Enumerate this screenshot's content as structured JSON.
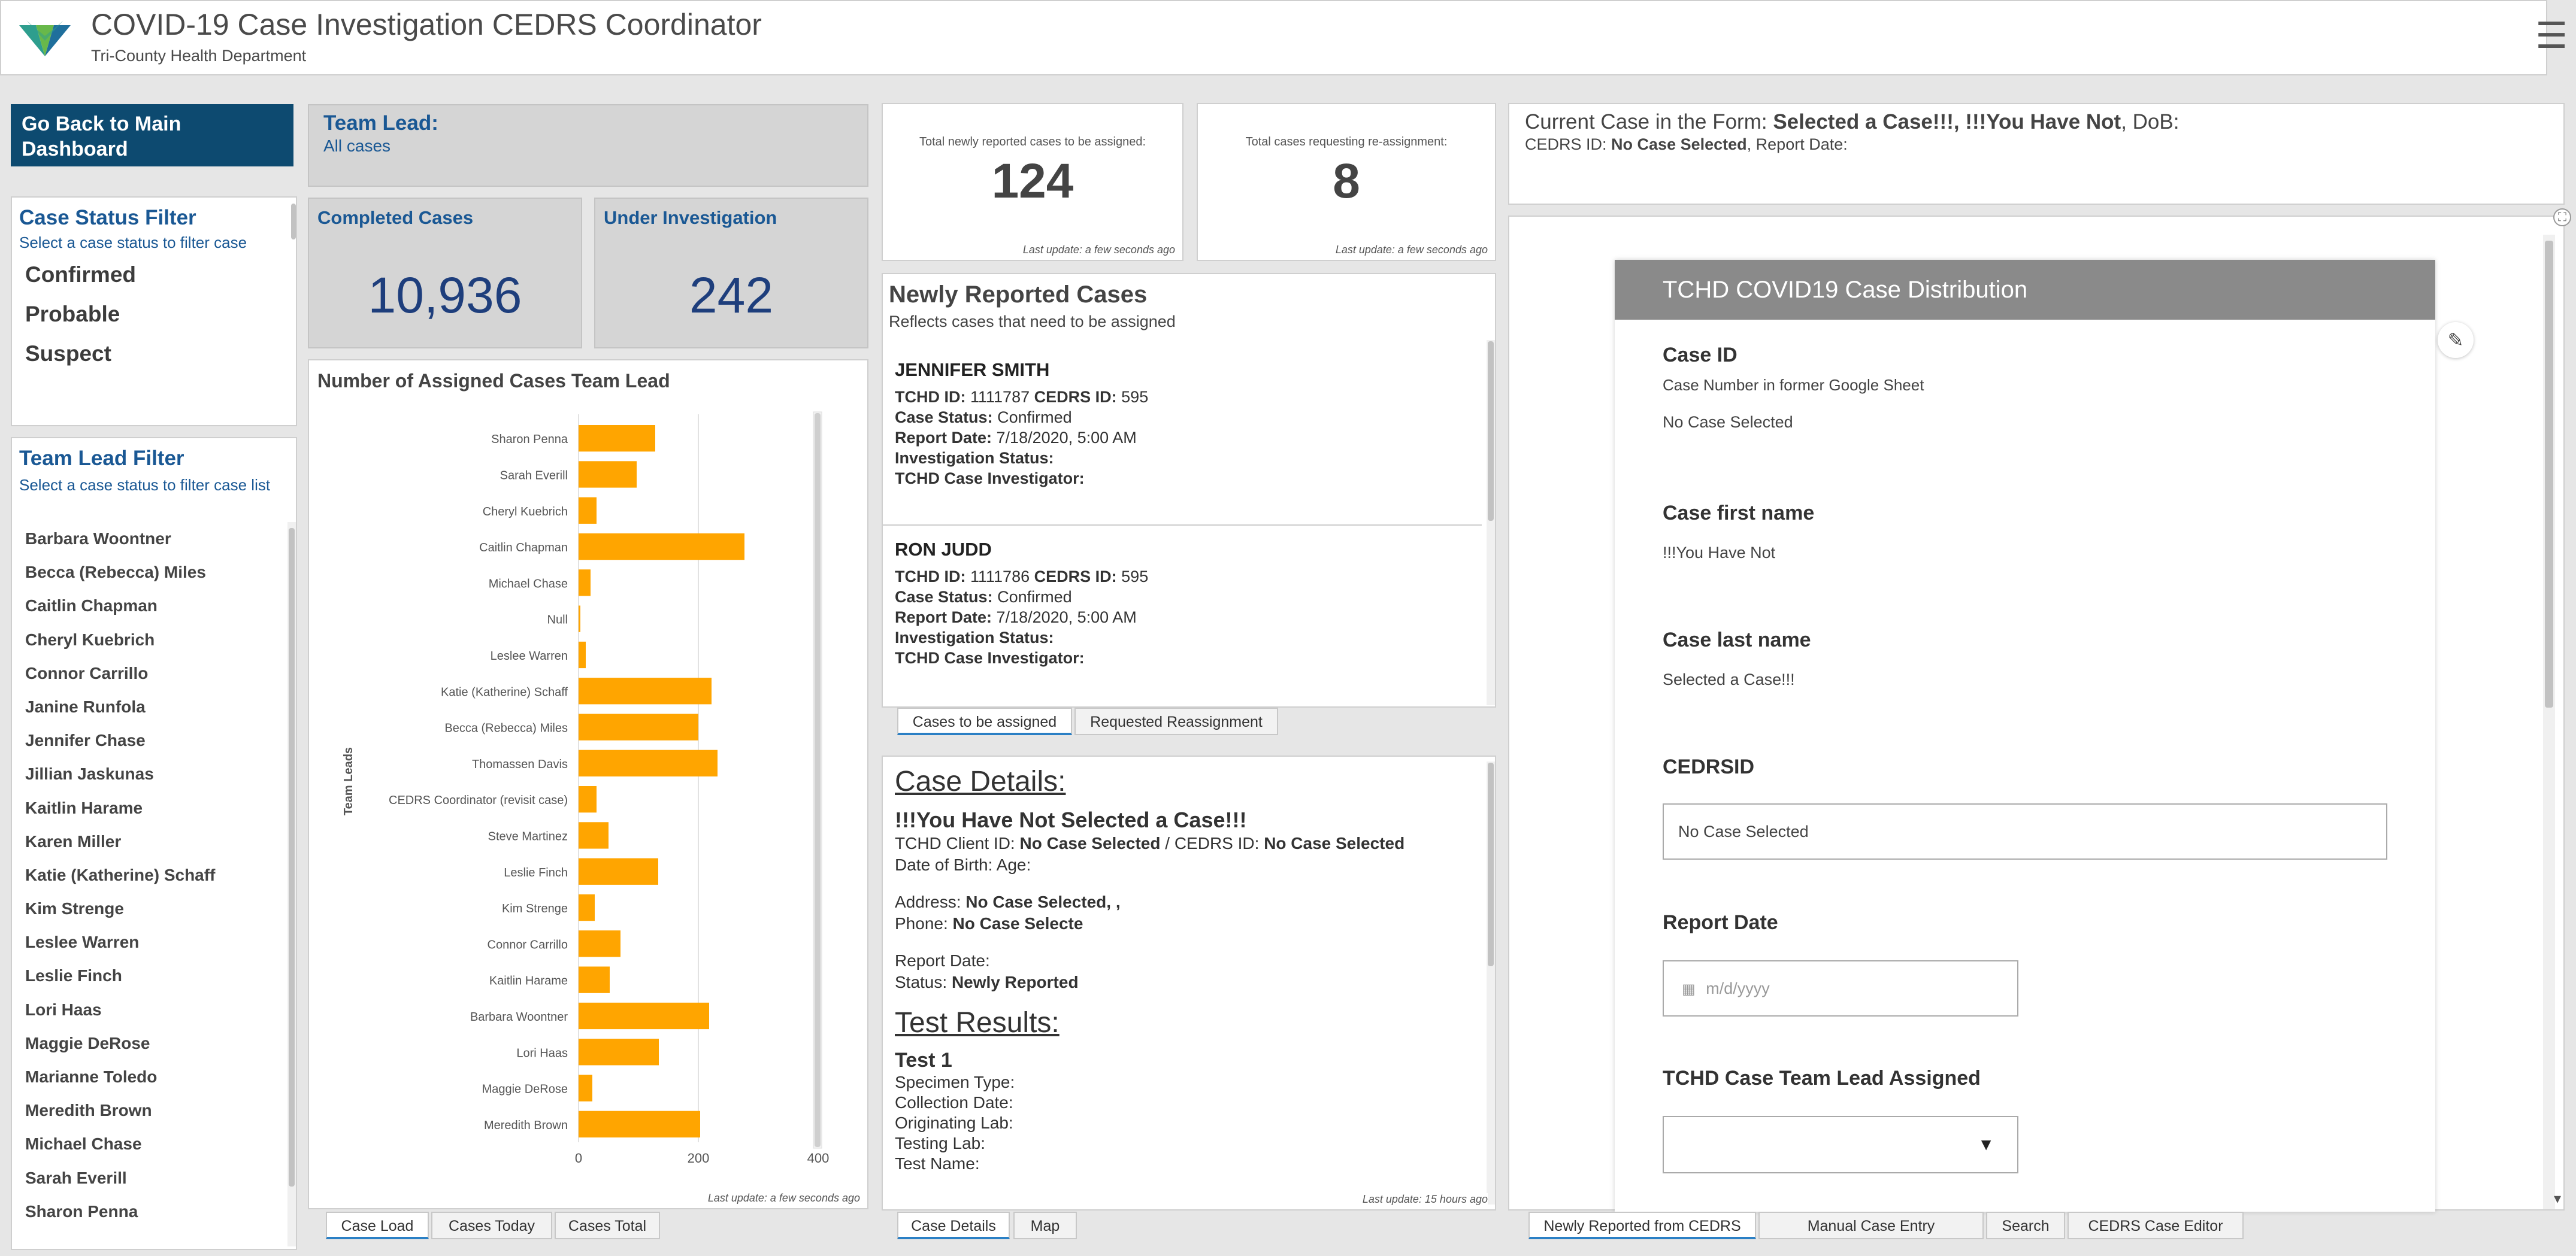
{
  "header": {
    "title": "COVID-19 Case Investigation CEDRS Coordinator",
    "subtitle": "Tri-County Health Department",
    "menu_icon": "☰"
  },
  "left": {
    "back_button": "Go Back to Main Dashboard",
    "status_filter": {
      "title": "Case Status Filter",
      "hint": "Select a case status to filter case",
      "items": [
        "Confirmed",
        "Probable",
        "Suspect"
      ]
    },
    "team_filter": {
      "title": "Team Lead Filter",
      "hint": "Select a case status to filter case list",
      "items": [
        "Barbara Woontner",
        "Becca (Rebecca) Miles",
        "Caitlin Chapman",
        "Cheryl Kuebrich",
        "Connor Carrillo",
        "Janine Runfola",
        "Jennifer Chase",
        "Jillian Jaskunas",
        "Kaitlin Harame",
        "Karen Miller",
        "Katie (Katherine) Schaff",
        "Kim Strenge",
        "Leslee Warren",
        "Leslie Finch",
        "Lori Haas",
        "Maggie DeRose",
        "Marianne Toledo",
        "Meredith Brown",
        "Michael Chase",
        "Sarah Everill",
        "Sharon Penna"
      ]
    }
  },
  "teamlead": {
    "label": "Team Lead:",
    "value": "All cases"
  },
  "stats": {
    "completed_label": "Completed Cases",
    "completed_value": "10,936",
    "under_label": "Under Investigation",
    "under_value": "242"
  },
  "chart_data": {
    "type": "bar",
    "orientation": "horizontal",
    "title": "Number of Assigned Cases Team Lead",
    "ylabel": "Team Leads",
    "xlabel": "",
    "xlim": [
      0,
      400
    ],
    "xticks": [
      "0",
      "200",
      "400"
    ],
    "categories": [
      "Sharon Penna",
      "Sarah Everill",
      "Cheryl Kuebrich",
      "Caitlin Chapman",
      "Michael Chase",
      "Null",
      "Leslee Warren",
      "Katie (Katherine) Schaff",
      "Becca (Rebecca) Miles",
      "Thomassen Davis",
      "CEDRS Coordinator (revisit case)",
      "Steve Martinez",
      "Leslie Finch",
      "Kim Strenge",
      "Connor Carrillo",
      "Kaitlin Harame",
      "Barbara Woontner",
      "Lori Haas",
      "Maggie DeRose",
      "Meredith Brown"
    ],
    "values": [
      128,
      97,
      30,
      277,
      20,
      3,
      12,
      222,
      200,
      232,
      30,
      50,
      133,
      27,
      70,
      52,
      218,
      134,
      23,
      203
    ],
    "bar_color": "#ffa500",
    "grid": true,
    "update": "Last update: a few seconds ago"
  },
  "left_tabs": [
    "Case Load",
    "Cases Today",
    "Cases Total"
  ],
  "counters": {
    "new_label": "Total newly reported cases to be assigned:",
    "new_value": "124",
    "reassign_label": "Total cases requesting re-assignment:",
    "reassign_value": "8",
    "update": "Last update: a few seconds ago"
  },
  "newly": {
    "title": "Newly Reported Cases",
    "subtitle": "Reflects cases that need to be assigned",
    "cards": [
      {
        "name": "JENNIFER SMITH",
        "tchd_label": "TCHD ID:",
        "tchd": "1111787",
        "cedrs_label": "CEDRS ID:",
        "cedrs": "595",
        "status_label": "Case Status:",
        "status": "Confirmed",
        "report_label": "Report Date:",
        "report": "7/18/2020, 5:00 AM",
        "inv_label": "Investigation Status:",
        "investigator_label": "TCHD Case Investigator:"
      },
      {
        "name": "RON JUDD",
        "tchd_label": "TCHD ID:",
        "tchd": "1111786",
        "cedrs_label": "CEDRS ID:",
        "cedrs": "595",
        "status_label": "Case Status:",
        "status": "Confirmed",
        "report_label": "Report Date:",
        "report": "7/18/2020, 5:00 AM",
        "inv_label": "Investigation Status:",
        "investigator_label": "TCHD Case Investigator:"
      }
    ],
    "tabs": [
      "Cases to be assigned",
      "Requested Reassignment"
    ]
  },
  "details": {
    "title": "Case Details:",
    "heading": "!!!You Have Not  Selected a Case!!!",
    "client_line_a": "TCHD Client ID:",
    "client_val": "No Case Selected",
    "client_sep": "/ CEDRS ID:",
    "cedrs_val": "No Case Selected",
    "dob": "Date of Birth:    Age:",
    "address_label": "Address:",
    "address": "No Case Selected, ,",
    "phone_label": "Phone:",
    "phone": "No Case Selecte",
    "report_date": "Report Date:",
    "status_label": "Status:",
    "status": "Newly Reported",
    "test_title": "Test Results:",
    "test1": "Test 1",
    "test_lines": [
      "Specimen Type:",
      "Collection Date:",
      "Originating Lab:",
      "Testing Lab:",
      "Test Name:"
    ],
    "update": "Last update: 15 hours ago",
    "tabs": [
      "Case Details",
      "Map"
    ]
  },
  "current": {
    "label": "Current Case in the Form:",
    "name": "Selected a Case!!!, !!!You Have Not",
    "dob": ", DoB:",
    "cedrs_label": "CEDRS ID:",
    "cedrs": "No Case Selected",
    "report": ", Report Date:"
  },
  "form": {
    "title": "TCHD COVID19 Case Distribution",
    "case_id_label": "Case ID",
    "case_id_desc": "Case Number in former Google Sheet",
    "case_id_value": "No Case Selected",
    "first_label": "Case first name",
    "first_value": "!!!You Have Not",
    "last_label": "Case last name",
    "last_value": "Selected a Case!!!",
    "cedrsid_label": "CEDRSID",
    "cedrsid_value": "No Case Selected",
    "report_label": "Report Date",
    "report_placeholder": "m/d/yyyy",
    "teamlead_label": "TCHD Case Team Lead Assigned"
  },
  "right_tabs": [
    "Newly Reported from CEDRS",
    "Manual Case Entry",
    "Search",
    "CEDRS Case Editor"
  ]
}
